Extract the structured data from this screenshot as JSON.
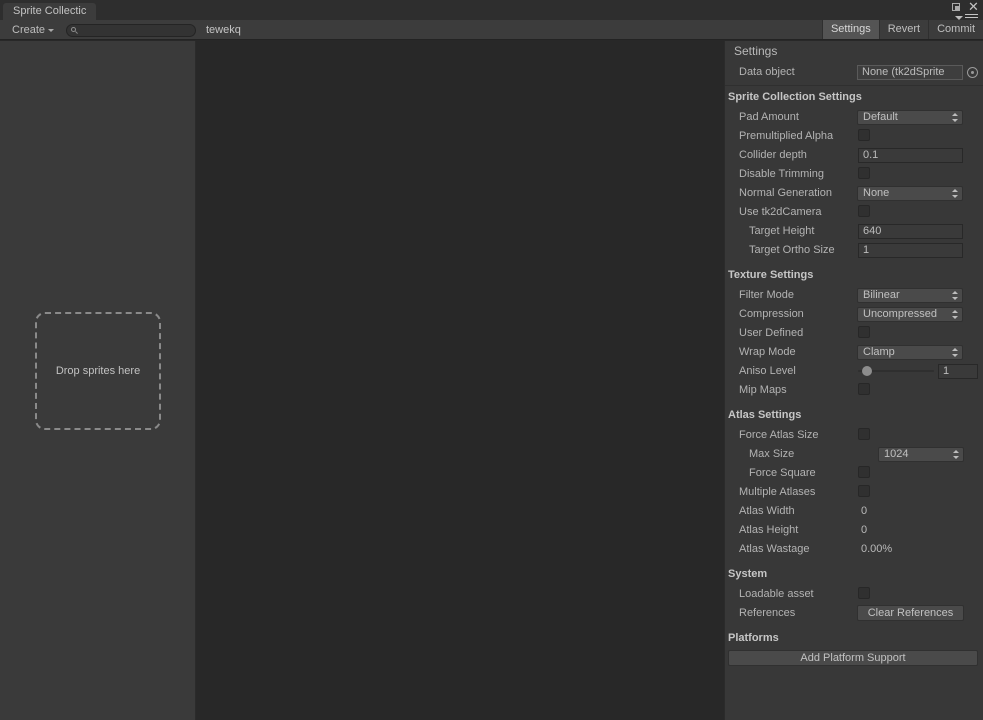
{
  "window": {
    "tab_title": "Sprite Collectic",
    "maximize_icon": "maximize-icon",
    "close_icon": "close-icon",
    "menu_icon": "hamburger-menu-icon"
  },
  "toolbar": {
    "create_label": "Create",
    "search_value": "",
    "search_placeholder": "",
    "name_label": "tewekq",
    "tabs": [
      {
        "label": "Settings",
        "active": true
      },
      {
        "label": "Revert",
        "active": false
      },
      {
        "label": "Commit",
        "active": false
      }
    ]
  },
  "left_panel": {
    "dropzone_label": "Drop sprites here"
  },
  "settings": {
    "title": "Settings",
    "data_object": {
      "label": "Data object",
      "value": "None (tk2dSprite",
      "picker_icon": "object-picker-icon"
    },
    "sections": [
      {
        "header": "Sprite Collection Settings",
        "rows": [
          {
            "label": "Pad Amount",
            "type": "dropdown",
            "value": "Default"
          },
          {
            "label": "Premultiplied Alpha",
            "type": "checkbox",
            "value": false
          },
          {
            "label": "Collider depth",
            "type": "textfield",
            "value": "0.1"
          },
          {
            "label": "Disable Trimming",
            "type": "checkbox",
            "value": false
          },
          {
            "label": "Normal Generation",
            "type": "dropdown",
            "value": "None"
          },
          {
            "label": "Use tk2dCamera",
            "type": "checkbox",
            "value": false
          },
          {
            "label": "Target Height",
            "type": "textfield",
            "value": "640",
            "indent": true
          },
          {
            "label": "Target Ortho Size",
            "type": "textfield",
            "value": "1",
            "indent": true
          }
        ]
      },
      {
        "header": "Texture Settings",
        "rows": [
          {
            "label": "Filter Mode",
            "type": "dropdown",
            "value": "Bilinear"
          },
          {
            "label": "Compression",
            "type": "dropdown",
            "value": "Uncompressed"
          },
          {
            "label": "User Defined",
            "type": "checkbox",
            "value": false
          },
          {
            "label": "Wrap Mode",
            "type": "dropdown",
            "value": "Clamp"
          },
          {
            "label": "Aniso Level",
            "type": "slider",
            "value": "1",
            "slider_pos": 0
          },
          {
            "label": "Mip Maps",
            "type": "checkbox",
            "value": false
          }
        ]
      },
      {
        "header": "Atlas Settings",
        "rows": [
          {
            "label": "Force Atlas Size",
            "type": "checkbox",
            "value": false
          },
          {
            "label": "Max Size",
            "type": "dropdown",
            "value": "1024",
            "indent": true
          },
          {
            "label": "Force Square",
            "type": "checkbox",
            "value": false,
            "indent": true
          },
          {
            "label": "Multiple Atlases",
            "type": "checkbox",
            "value": false
          },
          {
            "label": "Atlas Width",
            "type": "text",
            "value": "0"
          },
          {
            "label": "Atlas Height",
            "type": "text",
            "value": "0"
          },
          {
            "label": "Atlas Wastage",
            "type": "text",
            "value": "0.00%"
          }
        ]
      },
      {
        "header": "System",
        "rows": [
          {
            "label": "Loadable asset",
            "type": "checkbox",
            "value": false
          },
          {
            "label": "References",
            "type": "button",
            "value": "Clear References"
          }
        ]
      },
      {
        "header": "Platforms",
        "rows": [
          {
            "label": "",
            "type": "widebutton",
            "value": "Add Platform Support"
          }
        ]
      }
    ]
  },
  "colors": {
    "panel_bg": "#383838",
    "canvas_bg": "#282828",
    "sidebar_bg": "#3a3a3a",
    "toolbar_bg": "#3c3c3c",
    "active_tab": "#545454",
    "text": "#b3b3b3"
  }
}
